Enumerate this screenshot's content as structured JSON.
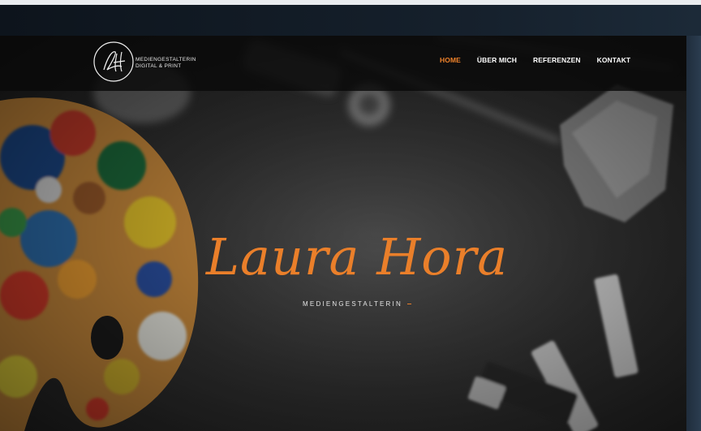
{
  "logo": {
    "monogram": "LH",
    "line1": "MEDIENGESTALTERIN",
    "line2": "DIGITAL & PRINT"
  },
  "nav": {
    "items": [
      {
        "label": "HOME",
        "active": true
      },
      {
        "label": "ÜBER MICH",
        "active": false
      },
      {
        "label": "REFERENZEN",
        "active": false
      },
      {
        "label": "KONTAKT",
        "active": false
      }
    ]
  },
  "hero": {
    "title": "Laura Hora",
    "subtitle": "MEDIENGESTALTERIN",
    "accent_color": "#ea7f2a"
  }
}
